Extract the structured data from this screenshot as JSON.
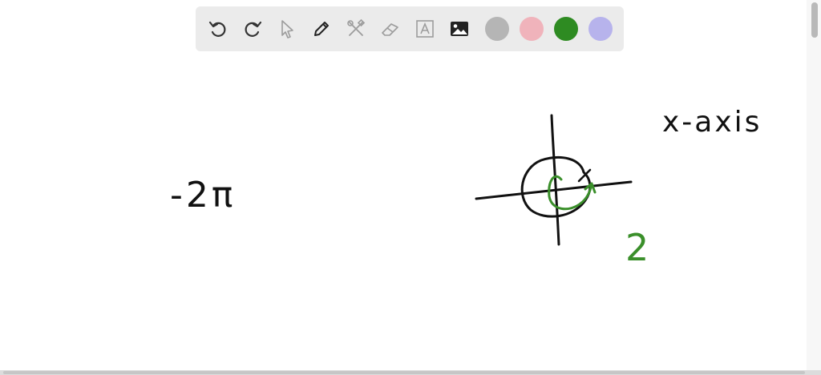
{
  "toolbar": {
    "tools": [
      {
        "name": "undo",
        "icon": "undo-icon"
      },
      {
        "name": "redo",
        "icon": "redo-icon"
      },
      {
        "name": "select",
        "icon": "pointer-icon"
      },
      {
        "name": "pen",
        "icon": "pencil-icon"
      },
      {
        "name": "tools",
        "icon": "crossed-tools-icon"
      },
      {
        "name": "eraser",
        "icon": "eraser-icon"
      },
      {
        "name": "text",
        "icon": "text-box-icon"
      },
      {
        "name": "image",
        "icon": "image-icon"
      }
    ],
    "colors": [
      "#b5b5b5",
      "#f0b3bb",
      "#2e8b22",
      "#b7b3ec"
    ],
    "selected_color": "#2e8b22"
  },
  "canvas": {
    "text_left": "-2π",
    "text_axis": "x-axis",
    "text_number": "2",
    "ink_black": "#111111",
    "ink_green": "#3a8f2a"
  }
}
